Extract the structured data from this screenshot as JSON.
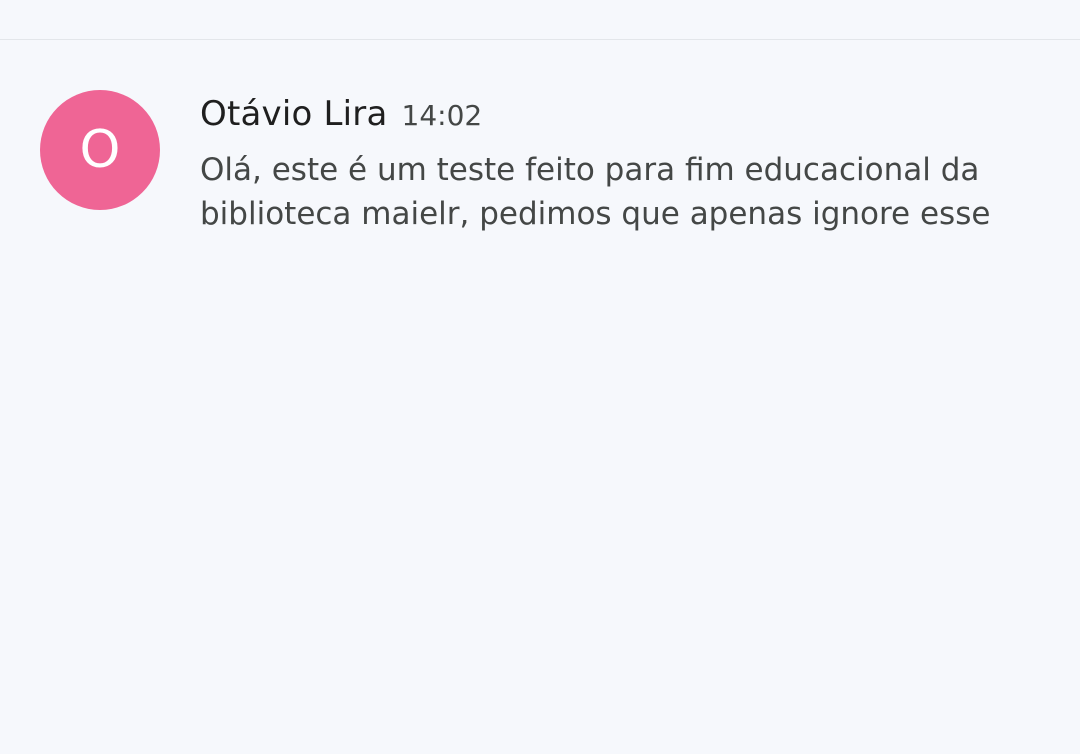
{
  "message": {
    "avatar_initial": "O",
    "avatar_color": "#ef6595",
    "sender": "Otávio Lira",
    "time": "14:02",
    "preview": "Olá, este é um teste feito para fim educacional da biblioteca maielr, pedimos que apenas ignore esse"
  }
}
